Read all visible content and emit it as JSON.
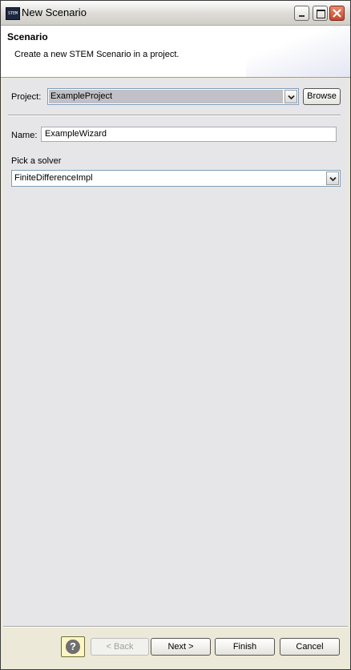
{
  "window": {
    "title": "New Scenario",
    "app_icon_text": "STEM"
  },
  "header": {
    "title": "Scenario",
    "description": "Create a new STEM Scenario in a project."
  },
  "form": {
    "project_label": "Project:",
    "project_value": "ExampleProject",
    "browse_label": "Browse",
    "name_label": "Name:",
    "name_value": "ExampleWizard",
    "solver_label": "Pick a solver",
    "solver_value": "FiniteDifferenceImpl"
  },
  "buttons": {
    "help_glyph": "?",
    "back_label": "< Back",
    "next_label": "Next >",
    "finish_label": "Finish",
    "cancel_label": "Cancel"
  },
  "icons": {
    "app": "stem-app-icon",
    "minimize": "minimize-icon",
    "maximize": "maximize-icon",
    "close": "close-icon",
    "dropdown": "chevron-down-icon",
    "help": "help-icon"
  },
  "colors": {
    "selection_highlight": "#c0c0c6",
    "close_button": "#c6452a",
    "help_button_bg": "#fdf6c4"
  }
}
